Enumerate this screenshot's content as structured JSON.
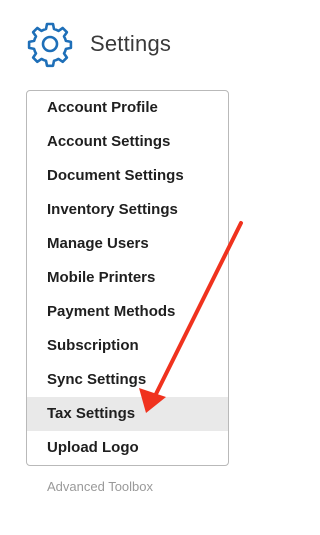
{
  "header": {
    "title": "Settings",
    "icon": "gear-icon",
    "icon_color": "#1e6fb8"
  },
  "menu": {
    "items": [
      {
        "label": "Account Profile"
      },
      {
        "label": "Account Settings"
      },
      {
        "label": "Document Settings"
      },
      {
        "label": "Inventory Settings"
      },
      {
        "label": "Manage Users"
      },
      {
        "label": "Mobile Printers"
      },
      {
        "label": "Payment Methods"
      },
      {
        "label": "Subscription"
      },
      {
        "label": "Sync Settings"
      },
      {
        "label": "Tax Settings"
      },
      {
        "label": "Upload Logo"
      }
    ],
    "active_label": "Tax Settings"
  },
  "footer": {
    "advanced_label": "Advanced Toolbox"
  },
  "annotation": {
    "arrow_color": "#f0321e",
    "points_to": "Tax Settings"
  }
}
